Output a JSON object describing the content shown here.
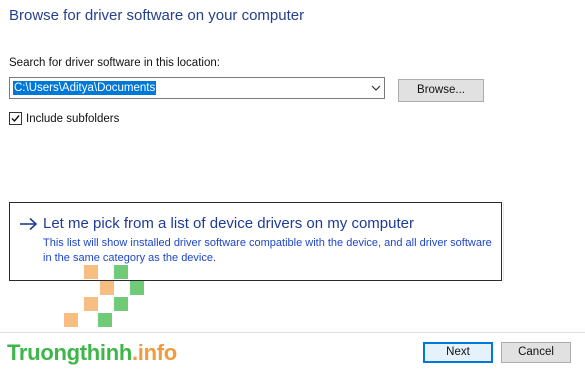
{
  "dialog": {
    "title": "Browse for driver software on your computer",
    "search_label": "Search for driver software in this location:",
    "path_value": "C:\\Users\\Aditya\\Documents",
    "browse_label": "Browse...",
    "include_subfolders": {
      "label": "Include subfolders",
      "checked": true
    }
  },
  "pick_option": {
    "title": "Let me pick from a list of device drivers on my computer",
    "description": "This list will show installed driver software compatible with the device, and all driver software in the same category as the device.",
    "icon": "arrow-right-icon"
  },
  "footer": {
    "next_label": "Next",
    "cancel_label": "Cancel"
  },
  "watermark": {
    "main": "Truongthinh",
    "suffix": ".info",
    "colors": {
      "green": "#3fb64a",
      "orange": "#f29a3c"
    }
  },
  "colors": {
    "selection": "#0078d7",
    "link_title": "#1e3c96",
    "link_desc": "#1e46c8"
  }
}
